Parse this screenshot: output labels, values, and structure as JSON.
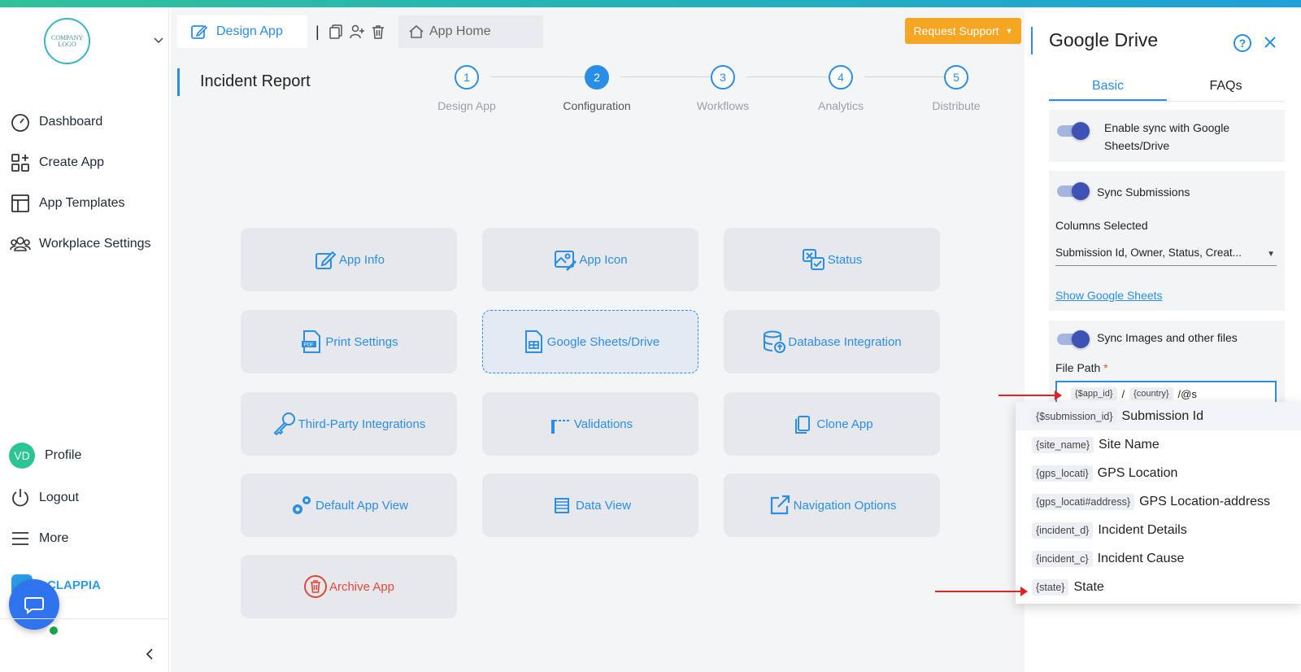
{
  "sidebar": {
    "logo_text": "COMPANY LOGO",
    "items": [
      {
        "label": "Dashboard",
        "icon": "dashboard-gauge-icon"
      },
      {
        "label": "Create App",
        "icon": "create-app-icon"
      },
      {
        "label": "App Templates",
        "icon": "templates-icon"
      },
      {
        "label": "Workplace Settings",
        "icon": "people-icon"
      }
    ],
    "profile": {
      "initials": "VD",
      "label": "Profile"
    },
    "logout_label": "Logout",
    "more_label": "More",
    "brand_text": "CLAPPIA"
  },
  "toptabs": {
    "design_label": "Design App",
    "separator": "|",
    "home_label": "App Home",
    "request_support": "Request Support"
  },
  "page_title": "Incident Report",
  "steps": [
    {
      "num": "1",
      "label": "Design App"
    },
    {
      "num": "2",
      "label": "Configuration"
    },
    {
      "num": "3",
      "label": "Workflows"
    },
    {
      "num": "4",
      "label": "Analytics"
    },
    {
      "num": "5",
      "label": "Distribute"
    }
  ],
  "cards": [
    {
      "label": "App Info",
      "icon": "edit-icon"
    },
    {
      "label": "App Icon",
      "icon": "image-edit-icon"
    },
    {
      "label": "Status",
      "icon": "status-icon"
    },
    {
      "label": "Print Settings",
      "icon": "pdf-icon"
    },
    {
      "label": "Google Sheets/Drive",
      "icon": "sheet-icon"
    },
    {
      "label": "Database Integration",
      "icon": "database-icon"
    },
    {
      "label": "Third-Party Integrations",
      "icon": "key-icon"
    },
    {
      "label": "Validations",
      "icon": "validation-icon"
    },
    {
      "label": "Clone App",
      "icon": "copy-icon"
    },
    {
      "label": "Default App View",
      "icon": "gears-icon"
    },
    {
      "label": "Data View",
      "icon": "table-icon"
    },
    {
      "label": "Navigation Options",
      "icon": "external-link-icon"
    },
    {
      "label": "Archive App",
      "icon": "trash-icon"
    }
  ],
  "panel": {
    "title": "Google Drive",
    "help": "?",
    "tabs": [
      "Basic",
      "FAQs"
    ],
    "enable_sync": "Enable sync with Google Sheets/Drive",
    "sync_submissions": "Sync Submissions",
    "columns_label": "Columns Selected",
    "columns_value": "Submission Id, Owner, Status, Creat...",
    "show_sheets": "Show Google Sheets",
    "sync_images": "Sync Images and other files",
    "file_path_label": "File Path",
    "required_mark": "*",
    "file_path": {
      "chip1": "{$app_id}",
      "sep1": "/",
      "chip2": "{country}",
      "typed": "/@s"
    }
  },
  "dropdown": [
    {
      "chip": "{$submission_id}",
      "label": "Submission Id"
    },
    {
      "chip": "{site_name}",
      "label": "Site Name"
    },
    {
      "chip": "{gps_locati}",
      "label": "GPS Location"
    },
    {
      "chip": "{gps_locati#address}",
      "label": "GPS Location-address"
    },
    {
      "chip": "{incident_d}",
      "label": "Incident Details"
    },
    {
      "chip": "{incident_c}",
      "label": "Incident Cause"
    },
    {
      "chip": "{state}",
      "label": "State"
    }
  ],
  "colors": {
    "accent": "#2a8de6",
    "warning": "#f6a623",
    "danger": "#e0483a",
    "toggle": "#3f51b5"
  }
}
